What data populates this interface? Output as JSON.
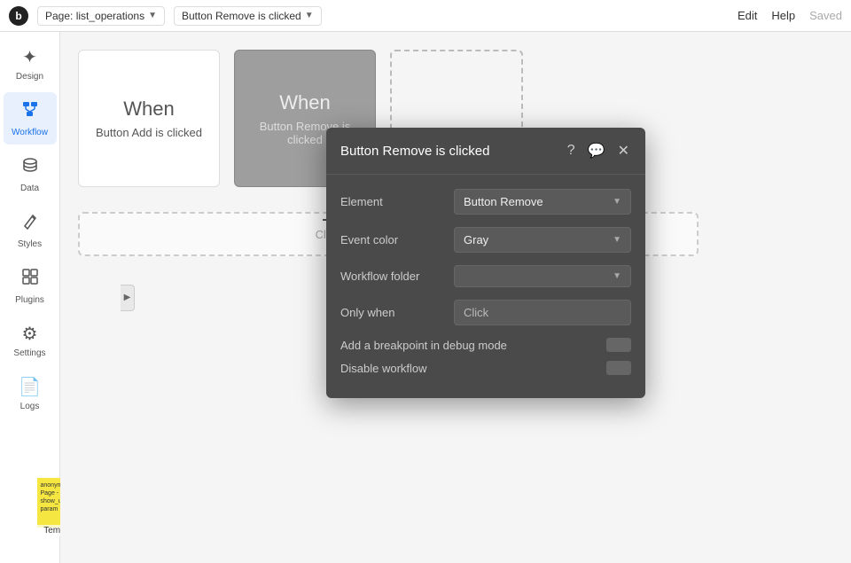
{
  "topbar": {
    "logo": "b",
    "page_label": "Page: list_operations",
    "page_chevron": "▼",
    "trigger_label": "Button Remove is clicked",
    "trigger_chevron": "▼",
    "edit_label": "Edit",
    "help_label": "Help",
    "saved_label": "Saved"
  },
  "sidebar": {
    "items": [
      {
        "id": "design",
        "label": "Design",
        "icon": "✦"
      },
      {
        "id": "workflow",
        "label": "Workflow",
        "icon": "⬡",
        "active": true
      },
      {
        "id": "data",
        "label": "Data",
        "icon": "◉"
      },
      {
        "id": "styles",
        "label": "Styles",
        "icon": "✏"
      },
      {
        "id": "plugins",
        "label": "Plugins",
        "icon": "⬚"
      },
      {
        "id": "settings",
        "label": "Settings",
        "icon": "⚙"
      },
      {
        "id": "logs",
        "label": "Logs",
        "icon": "📄"
      }
    ]
  },
  "canvas": {
    "trigger1": {
      "when": "When",
      "desc": "Button Add is clicked"
    },
    "trigger2": {
      "when": "When",
      "desc": "Button Remove is clicked"
    },
    "action_placeholder": "Click here to add an action..."
  },
  "modal": {
    "title": "Button Remove is clicked",
    "element_label": "Element",
    "element_value": "Button Remove",
    "event_color_label": "Event color",
    "event_color_value": "Gray",
    "workflow_folder_label": "Workflow folder",
    "workflow_folder_value": "",
    "only_when_label": "Only when",
    "only_when_placeholder": "Click",
    "debug_label": "Add a breakpoint in debug mode",
    "disable_label": "Disable workflow"
  },
  "sticky": {
    "content": "anonymous - Page - hide show_url param",
    "label": "Template"
  }
}
